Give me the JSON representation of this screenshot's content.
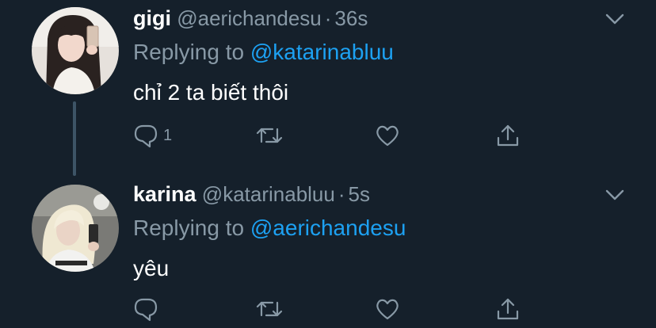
{
  "colors": {
    "background": "#15202b",
    "primary_text": "#ffffff",
    "secondary_text": "#8899a6",
    "accent": "#1da1f2",
    "thread_line": "#3d5466"
  },
  "tweets": [
    {
      "name": "gigi",
      "handle": "@aerichandesu",
      "separator": "·",
      "time": "36s",
      "reply_prefix": "Replying to",
      "reply_to": "@katarinabluu",
      "text": "chỉ 2 ta biết thôi",
      "reply_count": "1",
      "icons": [
        "chevron-down-icon",
        "reply-icon",
        "retweet-icon",
        "like-icon",
        "share-icon"
      ]
    },
    {
      "name": "karina",
      "handle": "@katarinabluu",
      "separator": "·",
      "time": "5s",
      "reply_prefix": "Replying to",
      "reply_to": "@aerichandesu",
      "text": "yêu",
      "reply_count": "",
      "icons": [
        "chevron-down-icon",
        "reply-icon",
        "retweet-icon",
        "like-icon",
        "share-icon"
      ]
    }
  ]
}
